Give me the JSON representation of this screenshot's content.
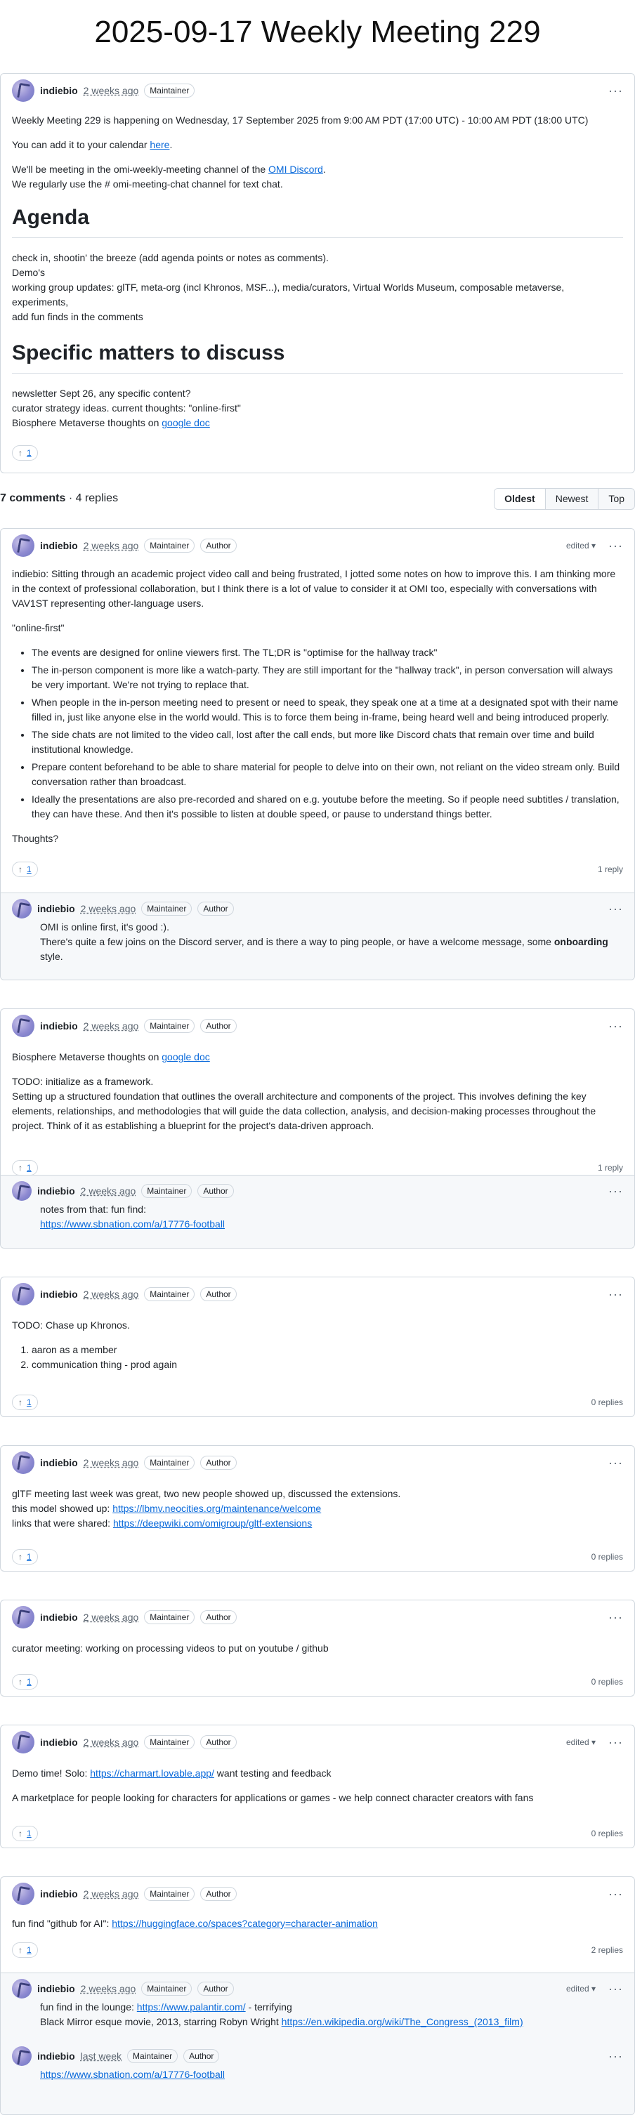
{
  "title": "2025-09-17 Weekly Meeting 229",
  "post": {
    "author": "indiebio",
    "time": "2 weeks ago",
    "badge": "Maintainer",
    "intro": "Weekly Meeting 229 is happening on Wednesday, 17 September 2025 from 9:00 AM PDT (17:00 UTC) - 10:00 AM PDT (18:00 UTC)",
    "calendar_pre": "You can add it to your calendar ",
    "calendar_link": "here",
    "calendar_post": ".",
    "meeting_pre": "We'll be meeting in the omi-weekly-meeting channel of the ",
    "meeting_link": "OMI Discord",
    "meeting_post": ".",
    "text_chat": "We regularly use the # omi-meeting-chat channel for text chat.",
    "agenda_heading": "Agenda",
    "agenda": [
      "check in, shootin' the breeze (add agenda points or notes as comments).",
      "Demo's",
      "working group updates: glTF, meta-org (incl Khronos, MSF...), media/curators, Virtual Worlds Museum, composable metaverse, experiments,",
      "add fun finds in the comments"
    ],
    "matters_heading": "Specific matters to discuss",
    "matters_1": "newsletter Sept 26, any specific content?",
    "matters_2": "curator strategy ideas. current thoughts: \"online-first\"",
    "matters_3_pre": "Biosphere Metaverse thoughts on ",
    "matters_3_link": "google doc",
    "upvotes": "1"
  },
  "comments_header": {
    "count": "7 comments",
    "replies": " · 4 replies",
    "sort": [
      "Oldest",
      "Newest",
      "Top"
    ]
  },
  "common": {
    "author": "indiebio",
    "time": "2 weeks ago",
    "time_last_week": "last week",
    "maintainer": "Maintainer",
    "author_badge": "Author",
    "edited": "edited",
    "upvotes": "1"
  },
  "c1": {
    "p1": "indiebio: Sitting through an academic project video call and being frustrated, I jotted some notes on how to improve this. I am thinking more in the context of professional collaboration, but I think there is a lot of value to consider it at OMI too, especially with conversations with VAV1ST representing other-language users.",
    "p2": "\"online-first\"",
    "bullets": [
      "The events are designed for online viewers first. The TL;DR is \"optimise for the hallway track\"",
      "The in-person component is more like a watch-party. They are still important for the \"hallway track\", in person conversation will always be very important. We're not trying to replace that.",
      "When people in the in-person meeting need to present or need to speak, they speak one at a time at a designated spot with their name filled in, just like anyone else in the world would. This is to force them being in-frame, being heard well and being introduced properly.",
      "The side chats are not limited to the video call, lost after the call ends, but more like Discord chats that remain over time and build institutional knowledge.",
      "Prepare content beforehand to be able to share material for people to delve into on their own, not reliant on the video stream only. Build conversation rather than broadcast.",
      "Ideally the presentations are also pre-recorded and shared on e.g. youtube before the meeting. So if people need subtitles / translation, they can have these. And then it's possible to listen at double speed, or pause to understand things better."
    ],
    "p3": "Thoughts?",
    "replycount": "1 reply",
    "r1_line1": "OMI is online first, it's good :).",
    "r1_line2_pre": "There's quite a few joins on the Discord server, and is there a way to ping people, or have a welcome message, some ",
    "r1_line2_bold": "onboarding",
    "r1_line2_post": " style."
  },
  "c2": {
    "p1_pre": "Biosphere Metaverse thoughts on ",
    "p1_link": "google doc",
    "todo": "TODO: initialize as a framework.",
    "p2": "Setting up a structured foundation that outlines the overall architecture and components of the project. This involves defining the key elements, relationships, and methodologies that will guide the data collection, analysis, and decision-making processes throughout the project. Think of it as establishing a blueprint for the project's data-driven approach.",
    "replycount": "1 reply",
    "r1_line1": "notes from that: fun find:",
    "r1_link": "https://www.sbnation.com/a/17776-football"
  },
  "c3": {
    "p1": "TODO: Chase up Khronos.",
    "items": [
      "aaron as a member",
      "communication thing - prod again"
    ],
    "replycount": "0 replies"
  },
  "c4": {
    "l1": "glTF meeting last week was great, two new people showed up, discussed the extensions.",
    "l2_pre": "this model showed up: ",
    "l2_link": "https://lbmv.neocities.org/maintenance/welcome",
    "l3_pre": "links that were shared: ",
    "l3_link": "https://deepwiki.com/omigroup/gltf-extensions",
    "replycount": "0 replies"
  },
  "c5": {
    "l1": "curator meeting: working on processing videos to put on youtube / github",
    "replycount": "0 replies"
  },
  "c6": {
    "l1_pre": "Demo time! Solo: ",
    "l1_link": "https://charmart.lovable.app/",
    "l1_post": " want testing and feedback",
    "l2": "A marketplace for people looking for characters for applications or games - we help connect character creators with fans",
    "replycount": "0 replies"
  },
  "c7": {
    "l1_pre": "fun find \"github for AI\": ",
    "l1_link": "https://huggingface.co/spaces?category=character-animation",
    "replycount": "2 replies",
    "r1_l1_pre": "fun find in the lounge: ",
    "r1_l1_link": "https://www.palantir.com/",
    "r1_l1_post": " - terrifying",
    "r1_l2_pre": "Black Mirror esque movie, 2013, starring Robyn Wright ",
    "r1_l2_link": "https://en.wikipedia.org/wiki/The_Congress_(2013_film)",
    "r2_link": "https://www.sbnation.com/a/17776-football"
  }
}
